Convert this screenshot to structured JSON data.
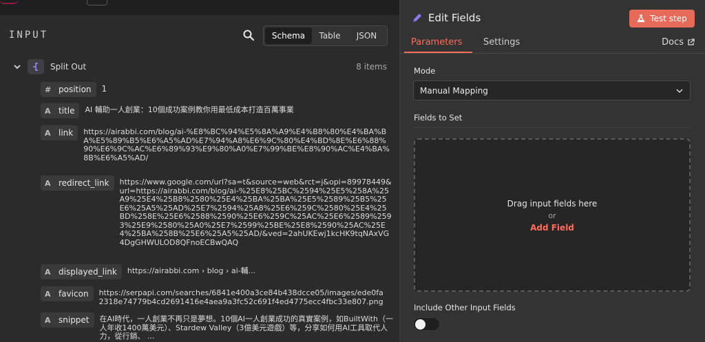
{
  "input_panel": {
    "title": "INPUT",
    "views": [
      "Schema",
      "Table",
      "JSON"
    ],
    "active_view": "Schema",
    "node": {
      "name": "Split Out",
      "items_count": "8 items",
      "icon": "split-out-icon"
    },
    "fields": [
      {
        "type": "#",
        "name": "position",
        "value": "1"
      },
      {
        "type": "A",
        "name": "title",
        "value": "AI 輔助一人創業：10個成功案例教你用最低成本打造百萬事業"
      },
      {
        "type": "A",
        "name": "link",
        "value": "https://airabbi.com/blog/ai-%E8%BC%94%E5%8A%A9%E4%B8%80%E4%BA%BA%E5%89%B5%E6%A5%AD%E7%94%A8%E6%9C%80%E4%BD%8E%E6%88%90%E6%9C%AC%E6%89%93%E9%80%A0%E7%99%BE%E8%90%AC%E4%BA%8B%E6%A5%AD/"
      },
      {
        "type": "A",
        "name": "redirect_link",
        "value": "https://www.google.com/url?sa=t&source=web&rct=j&opi=89978449&url=https://airabbi.com/blog/ai-%25E8%25BC%2594%25E5%258A%25A9%25E4%25B8%2580%25E4%25BA%25BA%25E5%2589%25B5%25E6%25A5%25AD%25E7%2594%25A8%25E6%259C%2580%25E4%25BD%258E%25E6%2588%2590%25E6%259C%25AC%25E6%2589%2593%25E9%2580%25A0%25E7%2599%25BE%25E8%2590%25AC%25E4%25BA%258B%25E6%25A5%25AD/&ved=2ahUKEwj1kcHK9tqNAxVG4DgGHWULOD8QFnoECBwQAQ"
      },
      {
        "type": "A",
        "name": "displayed_link",
        "value": "https://airabbi.com › blog › ai-輔..."
      },
      {
        "type": "A",
        "name": "favicon",
        "value": "https://serpapi.com/searches/6841e400a3ce84b438dcce05/images/ede0fa2318e74779b4cd2691416e4aea9a3fc52c691f4ed4775ecc4fbc33e807.png"
      },
      {
        "type": "A",
        "name": "snippet",
        "value": "在AI時代，一人創業不再只是夢想。10個AI一人創業成功的真實案例，如BuiltWith（一人年收1400萬美元）、Stardew Valley（3億美元遊戲）等，分享如何用AI工具取代人力，從行銷、 ..."
      }
    ]
  },
  "edit_panel": {
    "title": "Edit Fields",
    "test_button": "Test step",
    "tabs": [
      "Parameters",
      "Settings"
    ],
    "active_tab": "Parameters",
    "docs_label": "Docs",
    "mode_label": "Mode",
    "mode_value": "Manual Mapping",
    "fields_to_set_label": "Fields to Set",
    "dropzone": {
      "line1": "Drag input fields here",
      "line2": "or",
      "action": "Add Field"
    },
    "include_label": "Include Other Input Fields",
    "include_enabled": false
  },
  "colors": {
    "accent": "#ff6d5a",
    "button": "#e56a5a",
    "pencil": "#8b7ff0"
  }
}
